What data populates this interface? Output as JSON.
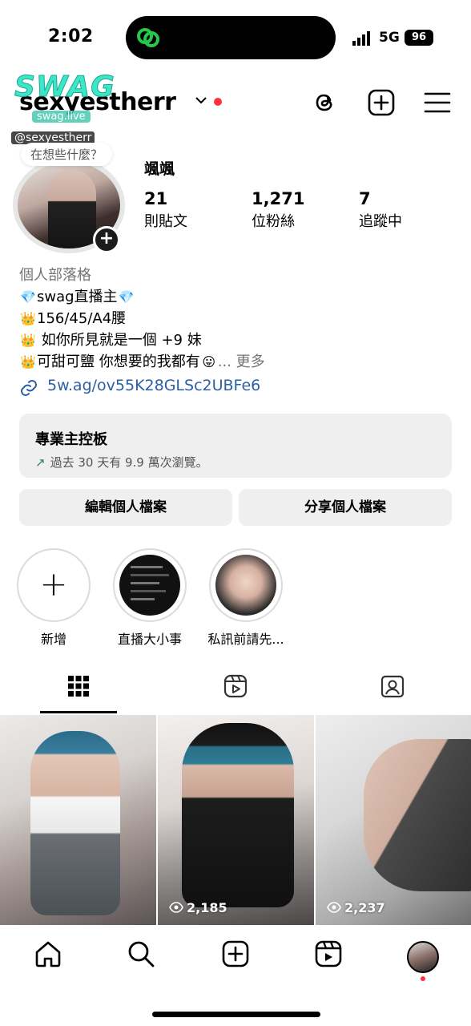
{
  "status_bar": {
    "time": "2:02",
    "network": "5G",
    "battery": "96"
  },
  "header": {
    "username": "sexyestherr",
    "icons": [
      "chevron-down-icon",
      "threads-icon",
      "create-post-icon",
      "menu-icon"
    ]
  },
  "watermark": {
    "logo": "SWAG",
    "site": "swag.live",
    "handle": "@sexyestherr"
  },
  "profile": {
    "note": "在想些什麼？",
    "display_name": "颯颯",
    "stats": [
      {
        "value": "21",
        "label": "則貼文"
      },
      {
        "value": "1,271",
        "label": "位粉絲"
      },
      {
        "value": "7",
        "label": "追蹤中"
      }
    ]
  },
  "bio": {
    "category": "個人部落格",
    "lines": [
      {
        "emoji": "💎",
        "text": "swag直播主",
        "emoji_end": "💎"
      },
      {
        "emoji": "👑",
        "text": "156/45/A4腰"
      },
      {
        "emoji": "👑",
        "text": " 如你所見就是一個 +9 妹"
      },
      {
        "emoji": "👑",
        "text": "可甜可鹽 你想要的我都有",
        "emoji_end": "😛",
        "more_prefix": "... ",
        "more": "更多"
      }
    ],
    "link": "5w.ag/ov55K28GLSc2UBFe6"
  },
  "dashboard": {
    "title": "專業主控板",
    "subtitle": "過去 30 天有 9.9 萬次瀏覽。"
  },
  "actions": {
    "edit": "編輯個人檔案",
    "share": "分享個人檔案"
  },
  "highlights": [
    {
      "label": "新增"
    },
    {
      "label": "直播大小事"
    },
    {
      "label": "私訊前請先..."
    }
  ],
  "tabs": [
    "grid-icon",
    "reels-icon",
    "tagged-icon"
  ],
  "posts": [
    {
      "views": ""
    },
    {
      "views": "2,185"
    },
    {
      "views": "2,237"
    }
  ],
  "colors": {
    "accent_red": "#ff3040",
    "link_blue": "#2b5fa6",
    "button_bg": "#efefef",
    "trend_green": "#1f8a4c"
  }
}
